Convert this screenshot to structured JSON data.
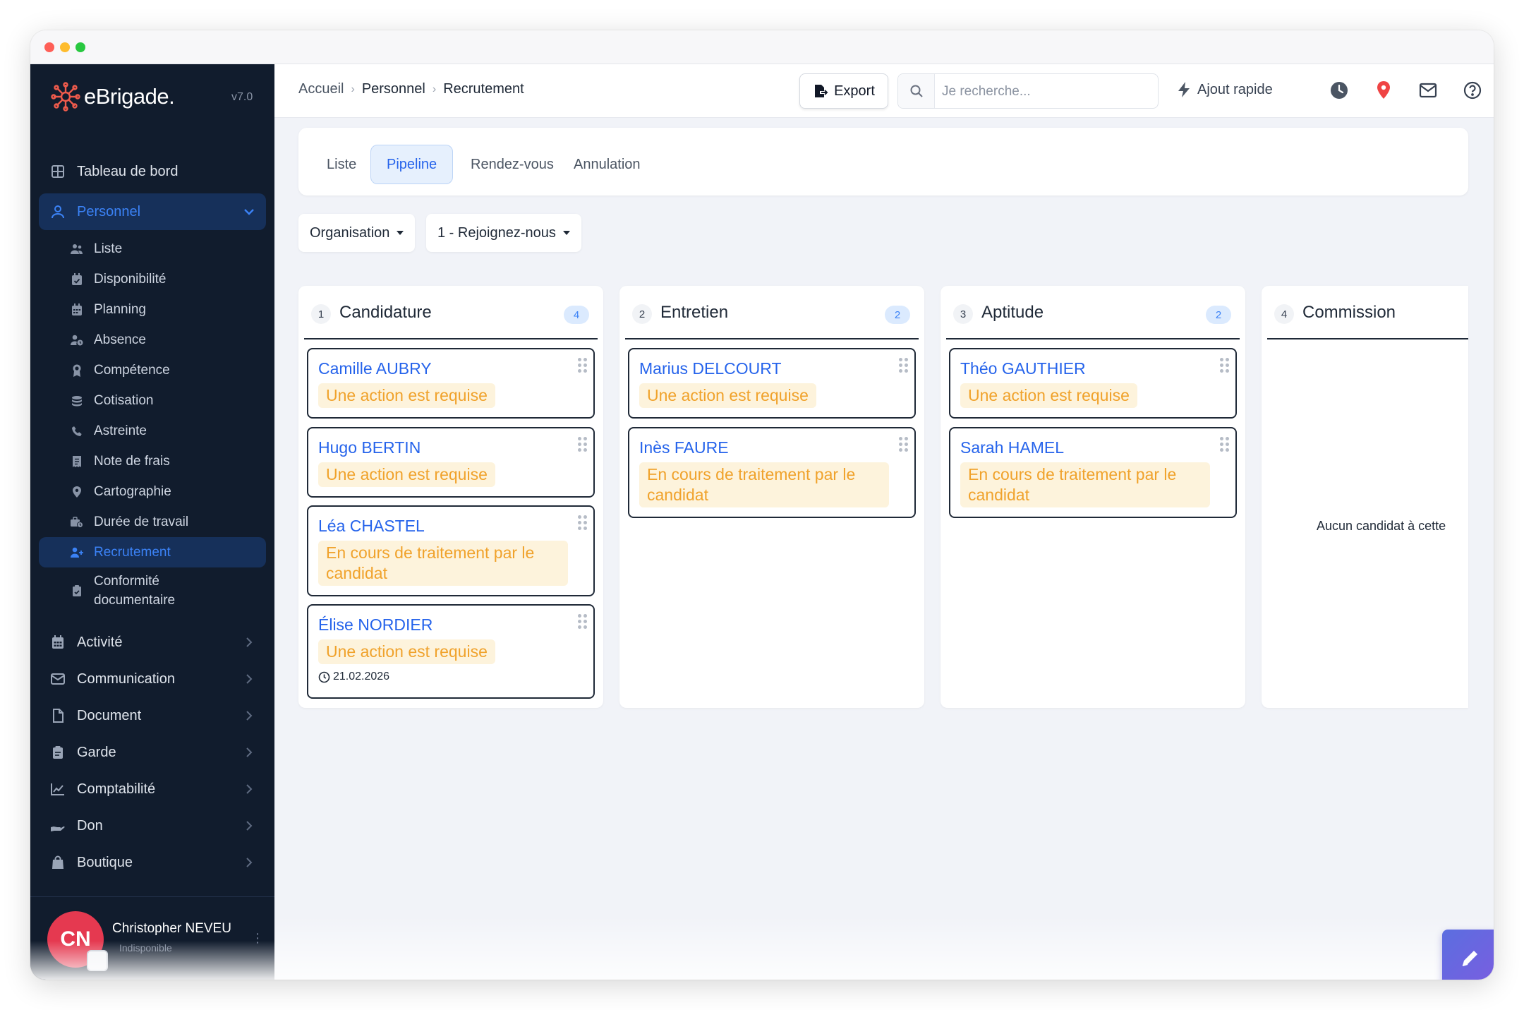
{
  "app": {
    "name": "eBrigade.",
    "version": "v7.0"
  },
  "sidebar": {
    "dashboard": "Tableau de bord",
    "personnel": "Personnel",
    "personnel_sub": [
      {
        "label": "Liste",
        "icon": "users-icon"
      },
      {
        "label": "Disponibilité",
        "icon": "calendar-check-icon"
      },
      {
        "label": "Planning",
        "icon": "calendar-grid-icon"
      },
      {
        "label": "Absence",
        "icon": "user-clock-icon"
      },
      {
        "label": "Compétence",
        "icon": "award-icon"
      },
      {
        "label": "Cotisation",
        "icon": "coins-icon"
      },
      {
        "label": "Astreinte",
        "icon": "phone-icon"
      },
      {
        "label": "Note de frais",
        "icon": "receipt-icon"
      },
      {
        "label": "Cartographie",
        "icon": "map-pin-icon"
      },
      {
        "label": "Durée de travail",
        "icon": "business-time-icon"
      },
      {
        "label": "Recrutement",
        "icon": "user-plus-icon"
      },
      {
        "label": "Conformité documentaire",
        "icon": "clipboard-check-icon"
      }
    ],
    "main": [
      {
        "label": "Activité",
        "icon": "calendar-icon"
      },
      {
        "label": "Communication",
        "icon": "envelope-icon"
      },
      {
        "label": "Document",
        "icon": "file-icon"
      },
      {
        "label": "Garde",
        "icon": "clipboard-icon"
      },
      {
        "label": "Comptabilité",
        "icon": "chart-line-icon"
      },
      {
        "label": "Don",
        "icon": "hand-holding-icon"
      },
      {
        "label": "Boutique",
        "icon": "shopping-bag-icon"
      }
    ],
    "user": {
      "initials": "CN",
      "name": "Christopher NEVEU",
      "status": "Indisponible"
    }
  },
  "topbar": {
    "breadcrumb": [
      "Accueil",
      "Personnel",
      "Recrutement"
    ],
    "export_label": "Export",
    "search_placeholder": "Je recherche...",
    "quick_add_label": "Ajout rapide"
  },
  "tabs": [
    "Liste",
    "Pipeline",
    "Rendez-vous",
    "Annulation"
  ],
  "active_tab": "Pipeline",
  "filters": {
    "organisation": "Organisation",
    "pipeline": "1 - Rejoignez-nous"
  },
  "columns": [
    {
      "num": "1",
      "title": "Candidature",
      "count": "4",
      "cards": [
        {
          "name": "Camille AUBRY",
          "status": "Une action est requise"
        },
        {
          "name": "Hugo BERTIN",
          "status": "Une action est requise"
        },
        {
          "name": "Léa CHASTEL",
          "status": "En cours de traitement par le candidat"
        },
        {
          "name": "Élise NORDIER",
          "status": "Une action est requise",
          "date": "21.02.2026"
        }
      ]
    },
    {
      "num": "2",
      "title": "Entretien",
      "count": "2",
      "cards": [
        {
          "name": "Marius DELCOURT",
          "status": "Une action est requise"
        },
        {
          "name": "Inès FAURE",
          "status": "En cours de traitement par le candidat"
        }
      ]
    },
    {
      "num": "3",
      "title": "Aptitude",
      "count": "2",
      "cards": [
        {
          "name": "Théo GAUTHIER",
          "status": "Une action est requise"
        },
        {
          "name": "Sarah HAMEL",
          "status": "En cours de traitement par le candidat"
        }
      ]
    },
    {
      "num": "4",
      "title": "Commission",
      "empty_message": "Aucun candidat à cette"
    }
  ],
  "colors": {
    "sidebar_bg": "#111c2d",
    "accent": "#2563eb",
    "status_text": "#f0a22b",
    "status_bg": "#fdf3dc"
  }
}
